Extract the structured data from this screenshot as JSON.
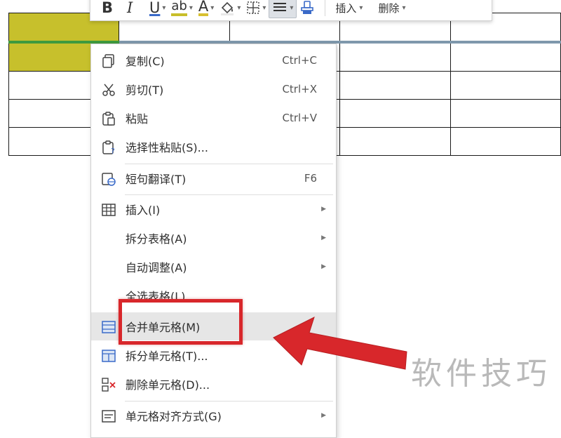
{
  "toolbar": {
    "bold": "B",
    "italic": "I",
    "underline": "U",
    "highlight": "ab",
    "font_color": "A",
    "insert_label": "插入",
    "delete_label": "删除"
  },
  "menu": {
    "items": [
      {
        "label": "复制(C)",
        "shortcut": "Ctrl+C",
        "icon": "copy-icon"
      },
      {
        "label": "剪切(T)",
        "shortcut": "Ctrl+X",
        "icon": "scissors-icon"
      },
      {
        "label": "粘贴",
        "shortcut": "Ctrl+V",
        "icon": "paste-icon"
      },
      {
        "label": "选择性粘贴(S)...",
        "icon": "paste-special-icon"
      },
      {
        "label": "短句翻译(T)",
        "shortcut": "F6",
        "icon": "translate-icon"
      },
      {
        "label": "插入(I)",
        "icon": "table-insert-icon",
        "submenu": true
      },
      {
        "label": "拆分表格(A)",
        "submenu": true
      },
      {
        "label": "自动调整(A)",
        "submenu": true
      },
      {
        "label": "全选表格(L)"
      },
      {
        "label": "合并单元格(M)",
        "icon": "merge-cells-icon",
        "highlighted": true
      },
      {
        "label": "拆分单元格(T)...",
        "icon": "split-cells-icon"
      },
      {
        "label": "删除单元格(D)...",
        "icon": "delete-cells-icon"
      },
      {
        "label": "单元格对齐方式(G)",
        "icon": "cell-align-icon",
        "submenu": true
      }
    ]
  },
  "watermark": "软件技巧",
  "colors": {
    "annotation_red": "#d8272b",
    "cell_highlight": "#c7c02c",
    "menu_highlight": "#e6e6e6"
  }
}
